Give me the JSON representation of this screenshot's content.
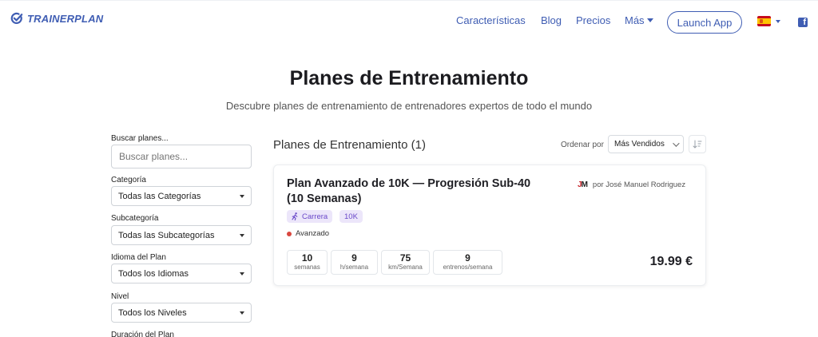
{
  "header": {
    "logo_text": "TRAINERPLAN",
    "nav": {
      "features": "Características",
      "blog": "Blog",
      "prices": "Precios",
      "more": "Más"
    },
    "launch_app": "Launch App",
    "language_flag_icon": "spain-flag-icon",
    "social_icon": "facebook-icon",
    "brand_color": "#3f5db3"
  },
  "hero": {
    "title": "Planes de Entrenamiento",
    "subtitle": "Descubre planes de entrenamiento de entrenadores expertos de todo el mundo"
  },
  "filters": {
    "search": {
      "label": "Buscar planes...",
      "placeholder": "Buscar planes..."
    },
    "category": {
      "label": "Categoría",
      "value": "Todas las Categorías"
    },
    "subcategory": {
      "label": "Subcategoría",
      "value": "Todas las Subcategorías"
    },
    "language": {
      "label": "Idioma del Plan",
      "value": "Todos los Idiomas"
    },
    "level": {
      "label": "Nivel",
      "value": "Todos los Niveles"
    },
    "duration": {
      "label": "Duración del Plan"
    }
  },
  "results": {
    "title": "Planes de Entrenamiento (1)",
    "order_label": "Ordenar por",
    "order_value": "Más Vendidos"
  },
  "plan": {
    "title": "Plan Avanzado de 10K — Progresión Sub-40 (10 Semanas)",
    "author": "por José Manuel Rodriguez",
    "author_logo": "JM",
    "tags": [
      {
        "label": "Carrera",
        "icon": "running-icon"
      },
      {
        "label": "10K"
      }
    ],
    "level": "Avanzado",
    "level_color": "#d9473f",
    "stats": [
      {
        "value": "10",
        "unit": "semanas"
      },
      {
        "value": "9",
        "unit": "h/semana"
      },
      {
        "value": "75",
        "unit": "km/Semana"
      },
      {
        "value": "9",
        "unit": "entrenos/semana"
      }
    ],
    "price": "19.99 €"
  }
}
